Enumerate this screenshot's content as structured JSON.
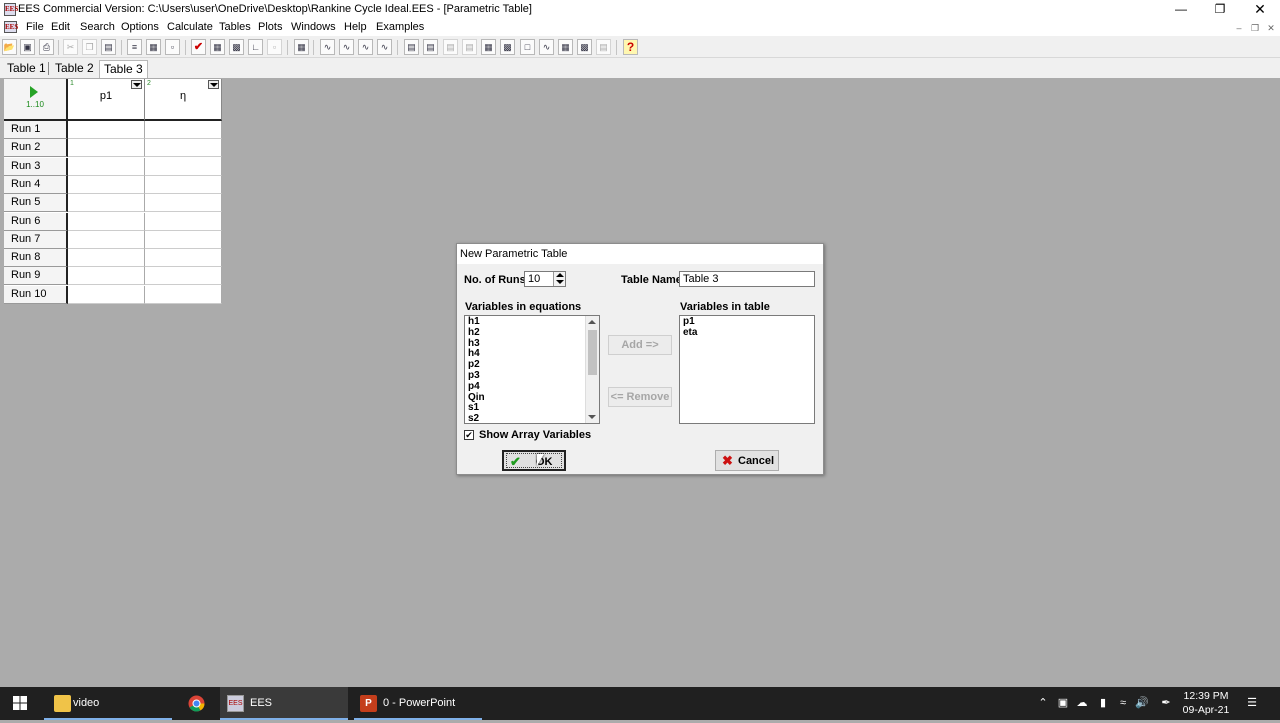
{
  "window": {
    "title": "EES Commercial Version:  C:\\Users\\user\\OneDrive\\Desktop\\Rankine Cycle Ideal.EES - [Parametric Table]",
    "app_icon": "EES"
  },
  "menu": [
    "File",
    "Edit",
    "Search",
    "Options",
    "Calculate",
    "Tables",
    "Plots",
    "Windows",
    "Help",
    "Examples"
  ],
  "tabs": [
    "Table 1",
    "Table 2",
    "Table 3"
  ],
  "active_tab": "Table 3",
  "table": {
    "run_range": "1..10",
    "columns": [
      {
        "index": "1",
        "name": "p1"
      },
      {
        "index": "2",
        "name": "η"
      }
    ],
    "rows": [
      "Run 1",
      "Run 2",
      "Run 3",
      "Run 4",
      "Run 5",
      "Run 6",
      "Run 7",
      "Run 8",
      "Run 9",
      "Run 10"
    ]
  },
  "dialog": {
    "title": "New Parametric Table",
    "runs_label": "No. of Runs",
    "runs_value": "10",
    "table_name_label": "Table Name",
    "table_name_value": "Table 3",
    "vars_in_equations_label": "Variables in equations",
    "vars_in_equations": [
      "h1",
      "h2",
      "h3",
      "h4",
      "p2",
      "p3",
      "p4",
      "Qin",
      "s1",
      "s2"
    ],
    "vars_in_table_label": "Variables in table",
    "vars_in_table": [
      "p1",
      "eta"
    ],
    "add_label": "Add =>",
    "remove_label": "<= Remove",
    "show_array_label": "Show Array Variables",
    "show_array_checked": "✔",
    "ok_label": "OK",
    "cancel_label": "Cancel"
  },
  "taskbar": {
    "apps": [
      {
        "name": "video",
        "icon": "folder-icon"
      },
      {
        "name": "",
        "icon": "chrome-icon"
      },
      {
        "name": "EES",
        "icon": "ees-icon"
      },
      {
        "name": "0 - PowerPoint",
        "icon": "powerpoint-icon"
      }
    ],
    "time": "12:39 PM",
    "date": "09-Apr-21"
  },
  "colors": {
    "workspace": "#ababab",
    "taskbar": "#202020",
    "ok_check": "#1e9b1e",
    "cancel_x": "#cc1111",
    "run_arrow": "#27a327"
  }
}
